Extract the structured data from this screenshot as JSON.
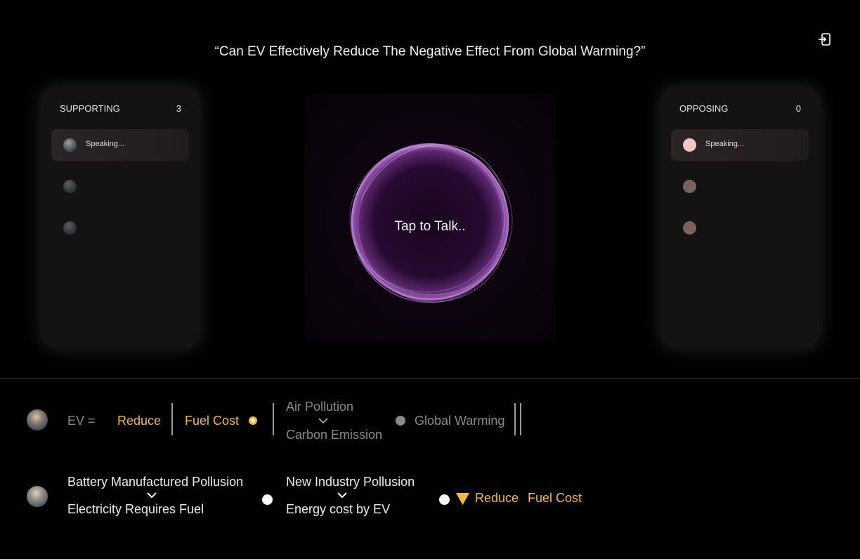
{
  "question": "“Can EV Effectively Reduce The Negative Effect From Global Warming?”",
  "icons": {
    "exit": "exit-icon",
    "speaker_avatar": "avatar",
    "node_dot": "dot-icon",
    "triangle": "triangle-down-icon"
  },
  "supporting": {
    "label": "SUPPORTING",
    "count": "3",
    "speaking_label": "Speaking..."
  },
  "opposing": {
    "label": "OPPOSING",
    "count": "0",
    "speaking_label": "Speaking..."
  },
  "center": {
    "tap_label": "Tap to Talk.."
  },
  "colors": {
    "accent_gold": "#f6b73c",
    "orb_purple": "#b04fd8",
    "speaking_pink": "#f4c7c0",
    "muted_brown": "#7a625d"
  },
  "argument_1": {
    "prefix": "EV =",
    "reduce": "Reduce",
    "fuel_cost": "Fuel Cost",
    "air_pollution": "Air Pollution",
    "carbon_emission": "Carbon Emission",
    "global_warming": "Global Warming"
  },
  "argument_2": {
    "battery": "Battery Manufactured Pollusion",
    "electricity": "Electricity Requires Fuel",
    "new_industry": "New Industry Pollusion",
    "energy_cost": "Energy cost by EV",
    "reduce": "Reduce",
    "fuel_cost": "Fuel Cost"
  }
}
